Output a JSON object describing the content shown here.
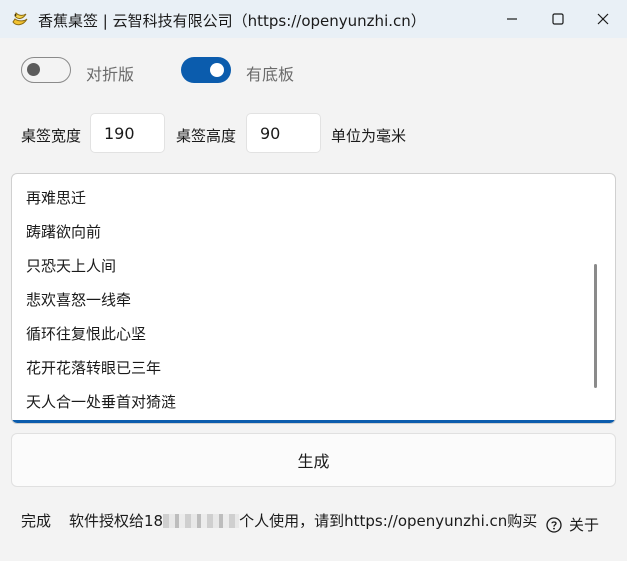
{
  "window": {
    "title": "香蕉桌签 | 云智科技有限公司（https://openyunzhi.cn）",
    "icon": "banana-icon"
  },
  "toggles": {
    "fold": {
      "label": "对折版",
      "on": false
    },
    "base": {
      "label": "有底板",
      "on": true
    }
  },
  "size": {
    "width_label": "桌签宽度",
    "width_value": "190",
    "height_label": "桌签高度",
    "height_value": "90",
    "unit_label": "单位为毫米"
  },
  "text_lines": [
    "再难思迁",
    "踌躇欲向前",
    "只恐天上人间",
    "悲欢喜怒一线牵",
    "循环往复恨此心坚",
    "花开花落转眼已三年",
    "天人合一处垂首对猗涟"
  ],
  "generate_button": "生成",
  "status": {
    "state": "完成",
    "license_prefix": "软件授权给18",
    "license_suffix": "个人使用，请到https://openyunzhi.cn购买"
  },
  "about_label": "关于",
  "colors": {
    "accent": "#0b5cad",
    "titlebar": "#e9f0f6",
    "background": "#f3f3f3"
  }
}
